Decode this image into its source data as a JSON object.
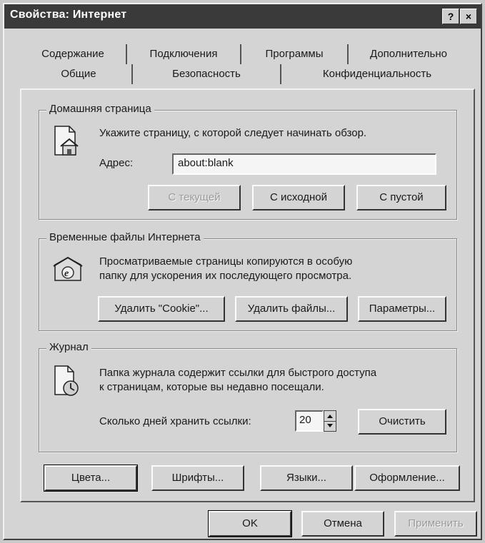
{
  "window": {
    "title": "Свойства: Интернет",
    "help_label": "?",
    "close_label": "×"
  },
  "tabs": {
    "row1": [
      "Содержание",
      "Подключения",
      "Программы",
      "Дополнительно"
    ],
    "row2": [
      "Общие",
      "Безопасность",
      "Конфиденциальность"
    ],
    "active": "Общие"
  },
  "home": {
    "legend": "Домашняя страница",
    "description": "Укажите страницу, с которой следует начинать обзор.",
    "address_label": "Адрес:",
    "address_value": "about:blank",
    "btn_current": "С текущей",
    "btn_default": "С исходной",
    "btn_blank": "С пустой",
    "icon": "home-page-icon"
  },
  "temp": {
    "legend": "Временные файлы Интернета",
    "description_line1": "Просматриваемые страницы копируются в особую",
    "description_line2": "папку для ускорения их последующего просмотра.",
    "btn_cookies": "Удалить \"Cookie\"...",
    "btn_files": "Удалить файлы...",
    "btn_settings": "Параметры...",
    "icon": "temp-files-folder-icon"
  },
  "history": {
    "legend": "Журнал",
    "description_line1": "Папка журнала содержит ссылки для быстрого доступа",
    "description_line2": "к страницам, которые вы недавно посещали.",
    "days_label": "Сколько дней хранить ссылки:",
    "days_value": "20",
    "btn_clear": "Очистить",
    "icon": "history-clock-icon"
  },
  "bottom_buttons": {
    "colors": "Цвета...",
    "fonts": "Шрифты...",
    "languages": "Языки...",
    "appearance": "Оформление..."
  },
  "dialog_buttons": {
    "ok": "OK",
    "cancel": "Отмена",
    "apply": "Применить"
  }
}
